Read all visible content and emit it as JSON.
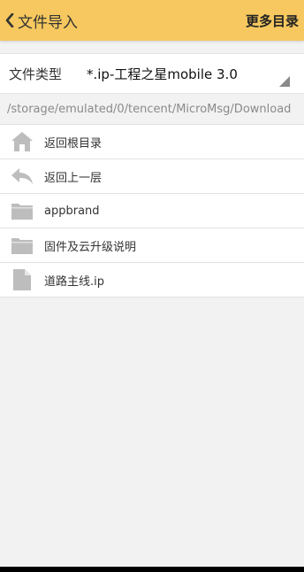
{
  "header": {
    "back_label": "文件导入",
    "more_label": "更多目录"
  },
  "file_type": {
    "label": "文件类型",
    "value": "*.ip-工程之星mobile 3.0"
  },
  "path": "/storage/emulated/0/tencent/MicroMsg/Download",
  "items": [
    {
      "label": "返回根目录",
      "icon": "home-icon"
    },
    {
      "label": "返回上一层",
      "icon": "back-arrow-icon"
    },
    {
      "label": "appbrand",
      "icon": "folder-icon"
    },
    {
      "label": "固件及云升级说明",
      "icon": "folder-icon"
    },
    {
      "label": "道路主线.ip",
      "icon": "file-icon"
    }
  ],
  "colors": {
    "header_bg": "#f6c85f",
    "icon_gray": "#bdbdbd"
  }
}
